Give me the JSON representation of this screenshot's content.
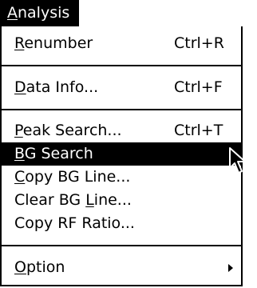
{
  "menubar": {
    "menu_title_mnemonic": "A",
    "menu_title_rest": "nalysis"
  },
  "menu": {
    "items": [
      {
        "mn": "R",
        "rest": "enumber",
        "shortcut": "Ctrl+R"
      },
      {
        "mn": "D",
        "rest": "ata Info...",
        "shortcut": "Ctrl+F"
      },
      {
        "mn": "P",
        "rest": "eak Search...",
        "shortcut": "Ctrl+T"
      },
      {
        "mn": "B",
        "rest": "G Search",
        "shortcut": "",
        "highlighted": true
      },
      {
        "mn": "C",
        "rest": "opy BG Line...",
        "shortcut": ""
      },
      {
        "pre": "Clear BG ",
        "mn": "L",
        "rest": "ine...",
        "shortcut": ""
      },
      {
        "pre": "Copy RF Ratio...",
        "mn": "",
        "rest": "",
        "shortcut": ""
      },
      {
        "mn": "O",
        "rest": "ption",
        "shortcut": "",
        "submenu": true
      }
    ]
  },
  "colors": {
    "highlight_bg": "#000000",
    "highlight_fg": "#ffffff",
    "menu_bg": "#ffffff"
  },
  "icons": {
    "cursor": "mouse-pointer-arrow-icon",
    "submenu": "submenu-triangle-icon"
  }
}
